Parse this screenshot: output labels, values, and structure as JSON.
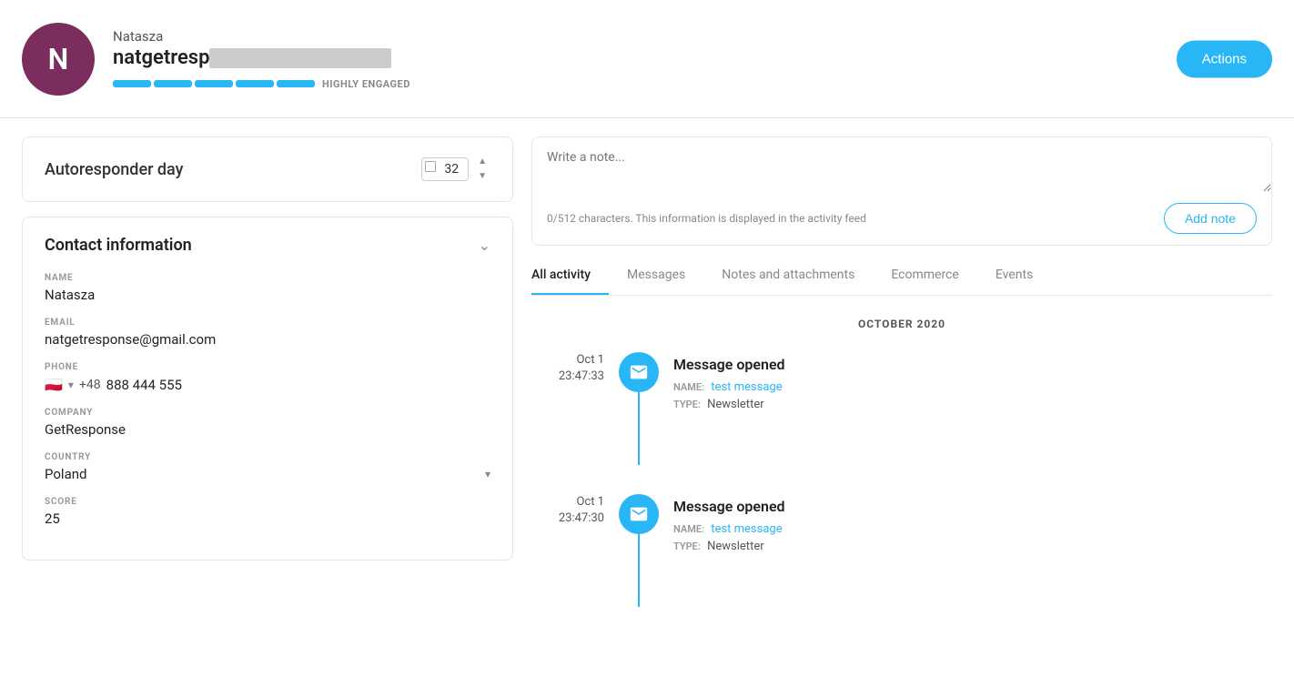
{
  "header": {
    "avatar_letter": "N",
    "name": "Natasza",
    "email_visible": "natgetresp",
    "engagement_label": "HIGHLY ENGAGED",
    "engagement_segments": [
      {
        "color": "#29b6f6",
        "filled": true
      },
      {
        "color": "#29b6f6",
        "filled": true
      },
      {
        "color": "#29b6f6",
        "filled": true
      },
      {
        "color": "#29b6f6",
        "filled": true
      },
      {
        "color": "#29b6f6",
        "filled": true
      }
    ],
    "actions_label": "Actions"
  },
  "autoresponder": {
    "label": "Autoresponder day",
    "day_value": "32"
  },
  "contact": {
    "section_title": "Contact information",
    "fields": {
      "name_label": "NAME",
      "name_value": "Natasza",
      "email_label": "EMAIL",
      "email_value": "natgetresponse@gmail.com",
      "phone_label": "PHONE",
      "phone_flag": "🇵🇱",
      "phone_code": "+48",
      "phone_number": "888 444 555",
      "company_label": "COMPANY",
      "company_value": "GetResponse",
      "country_label": "COUNTRY",
      "country_value": "Poland",
      "score_label": "SCORE",
      "score_value": "25"
    }
  },
  "note": {
    "placeholder": "Write a note...",
    "char_info": "0/512 characters. This information is displayed in the activity feed",
    "add_button": "Add note"
  },
  "tabs": {
    "items": [
      {
        "label": "All activity",
        "active": true
      },
      {
        "label": "Messages",
        "active": false
      },
      {
        "label": "Notes and attachments",
        "active": false
      },
      {
        "label": "Ecommerce",
        "active": false
      },
      {
        "label": "Events",
        "active": false
      }
    ]
  },
  "activity": {
    "month": "OCTOBER 2020",
    "items": [
      {
        "date": "Oct 1",
        "time": "23:47:33",
        "title": "Message opened",
        "name_label": "NAME:",
        "name_value": "test message",
        "type_label": "TYPE:",
        "type_value": "Newsletter"
      },
      {
        "date": "Oct 1",
        "time": "23:47:30",
        "title": "Message opened",
        "name_label": "NAME:",
        "name_value": "test message",
        "type_label": "TYPE:",
        "type_value": "Newsletter"
      }
    ]
  }
}
